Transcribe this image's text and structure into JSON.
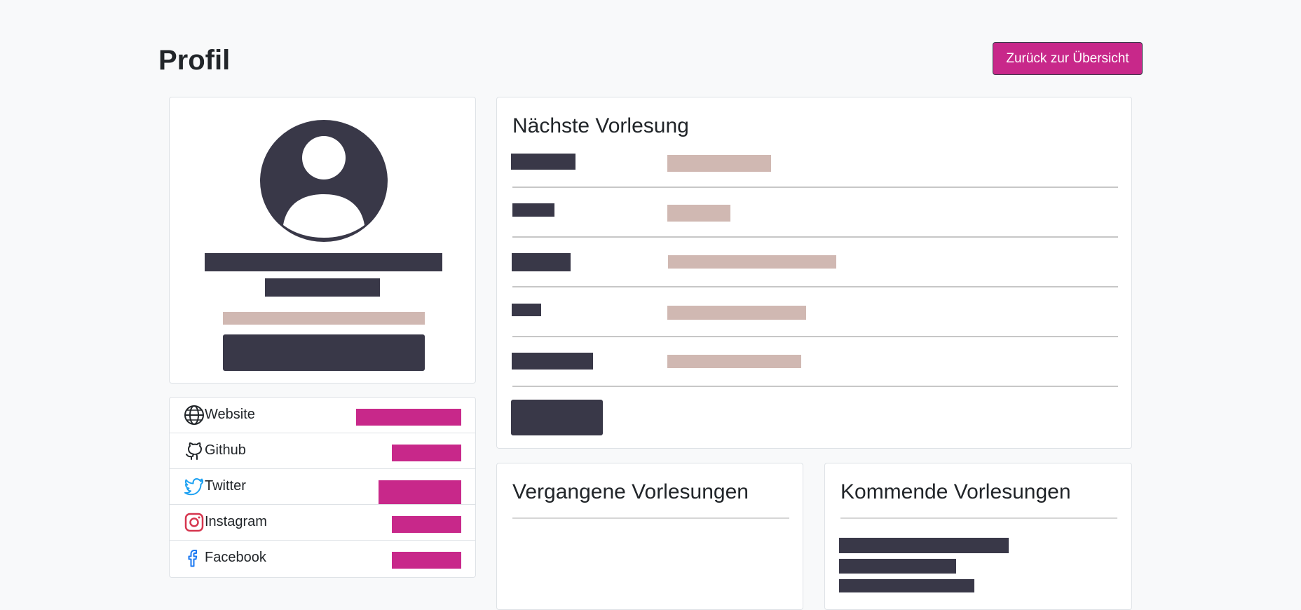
{
  "header": {
    "title": "Profil",
    "back_button_label": "Zurück zur Übersicht"
  },
  "profile": {
    "avatar_icon": "user-circle-icon"
  },
  "links": [
    {
      "label": "Website",
      "icon": "globe-icon"
    },
    {
      "label": "Github",
      "icon": "github-icon"
    },
    {
      "label": "Twitter",
      "icon": "twitter-icon"
    },
    {
      "label": "Instagram",
      "icon": "instagram-icon"
    },
    {
      "label": "Facebook",
      "icon": "facebook-icon"
    }
  ],
  "next_lecture": {
    "title": "Nächste Vorlesung"
  },
  "past_lectures": {
    "title": "Vergangene Vorlesungen"
  },
  "upcoming_lectures": {
    "title": "Kommende Vorlesungen"
  },
  "colors": {
    "accent": "#c8288a",
    "redacted_dark": "#393848",
    "redacted_light": "#d0b8b2",
    "background": "#f8f9fa"
  }
}
